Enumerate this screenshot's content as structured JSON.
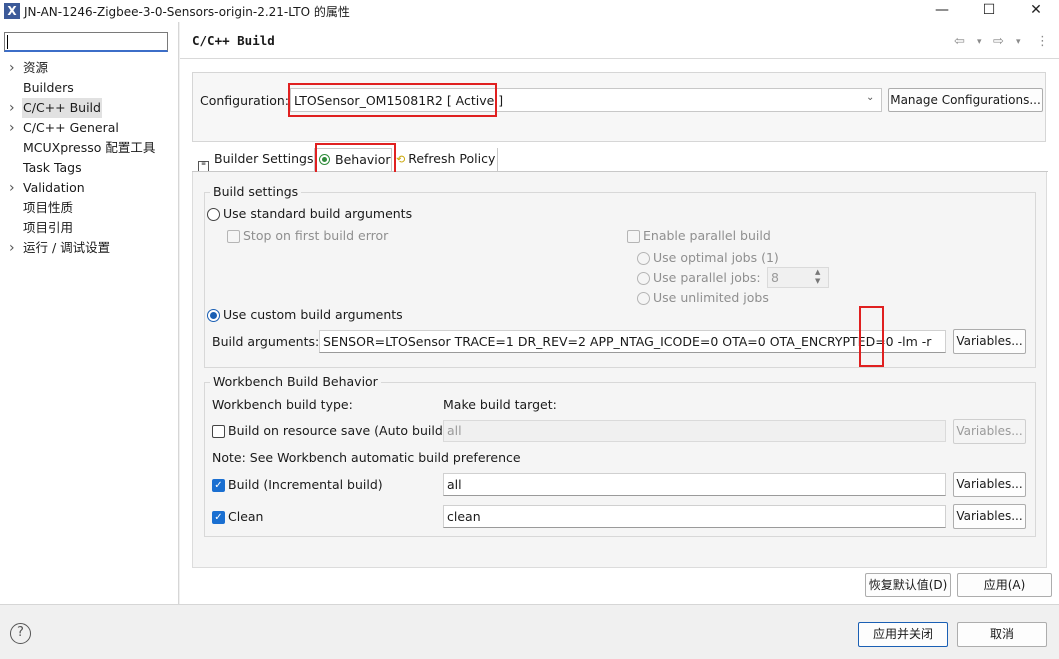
{
  "window": {
    "title": "JN-AN-1246-Zigbee-3-0-Sensors-origin-2.21-LTO 的属性",
    "icon": "x-app-icon",
    "minimize": "—",
    "maximize": "☐",
    "close": "✕"
  },
  "sidebar": {
    "filter_value": "",
    "items": [
      {
        "label": "资源",
        "has_children": true
      },
      {
        "label": "Builders",
        "has_children": false
      },
      {
        "label": "C/C++ Build",
        "has_children": true,
        "selected": true
      },
      {
        "label": "C/C++ General",
        "has_children": true
      },
      {
        "label": "MCUXpresso 配置工具",
        "has_children": false
      },
      {
        "label": "Task Tags",
        "has_children": false
      },
      {
        "label": "Validation",
        "has_children": true
      },
      {
        "label": "项目性质",
        "has_children": false
      },
      {
        "label": "项目引用",
        "has_children": false
      },
      {
        "label": "运行 / 调试设置",
        "has_children": true
      }
    ]
  },
  "page": {
    "title": "C/C++ Build",
    "nav": {
      "back": "⇦",
      "forward": "⇨",
      "menu": "▾",
      "more": "⋮"
    }
  },
  "configuration": {
    "label": "Configuration:",
    "value": "LTOSensor_OM15081R2  [ Active ]",
    "manage_button": "Manage Configurations..."
  },
  "tabs": [
    {
      "label": "Builder Settings",
      "icon": "builder-settings-icon"
    },
    {
      "label": "Behavior",
      "icon": "radio-behavior-icon",
      "active": true
    },
    {
      "label": "Refresh Policy",
      "icon": "refresh-policy-icon"
    }
  ],
  "build_settings": {
    "group_title": "Build settings",
    "use_standard": "Use standard build arguments",
    "stop_on_first_error": "Stop on first build error",
    "enable_parallel": "Enable parallel build",
    "use_optimal_jobs": "Use optimal jobs (1)",
    "use_parallel_jobs": "Use parallel jobs:",
    "parallel_jobs_value": "8",
    "use_unlimited_jobs": "Use unlimited jobs",
    "use_custom": "Use custom build arguments",
    "build_arguments_label": "Build arguments:",
    "build_arguments_value": "SENSOR=LTOSensor TRACE=1 DR_REV=2 APP_NTAG_ICODE=0 OTA=0 OTA_ENCRYPTED=0 -lm -r",
    "variables_button": "Variables..."
  },
  "workbench": {
    "group_title": "Workbench Build Behavior",
    "build_type_label": "Workbench build type:",
    "make_target_label": "Make build target:",
    "auto_build_label": "Build on resource save (Auto build)",
    "auto_build_target": "all",
    "note": "Note: See Workbench automatic build preference",
    "incremental_label": "Build (Incremental build)",
    "incremental_target": "all",
    "clean_label": "Clean",
    "clean_target": "clean",
    "variables_button": "Variables..."
  },
  "footer": {
    "restore_defaults": "恢复默认值(D)",
    "apply": "应用(A)",
    "apply_and_close": "应用并关闭",
    "cancel": "取消",
    "help": "?"
  },
  "colors": {
    "highlight_red": "#e02020",
    "checkbox_blue": "#1a6fd1",
    "primary_button_border": "#1a5fb4"
  }
}
